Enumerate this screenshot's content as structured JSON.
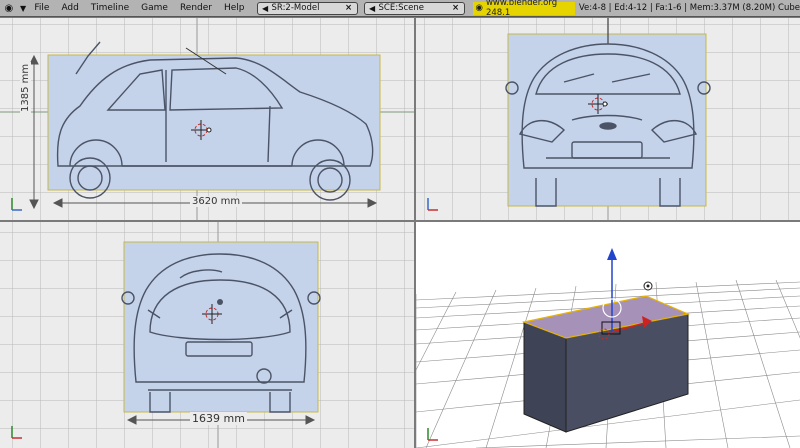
{
  "header": {
    "menu": [
      {
        "label": "File"
      },
      {
        "label": "Add"
      },
      {
        "label": "Timeline"
      },
      {
        "label": "Game"
      },
      {
        "label": "Render"
      },
      {
        "label": "Help"
      }
    ],
    "screen_field": {
      "value": "SR:2-Model"
    },
    "scene_field": {
      "value": "SCE:Scene"
    },
    "site_version": "www.blender.org 248.1",
    "stats": "Ve:4-8 | Ed:4-12 | Fa:1-6 | Mem:3.37M (8.20M) Cube"
  },
  "views": {
    "side": {
      "dim_height": "1385 mm",
      "dim_length": "3620 mm"
    },
    "top": {
      "dim_width": "1639 mm"
    }
  },
  "colors": {
    "blueprint": "#c4d2ea",
    "viewport_bg": "#ececec",
    "cube_top": "#a691b8",
    "cube_side": "#3f4356",
    "selection": "#e8b400"
  }
}
